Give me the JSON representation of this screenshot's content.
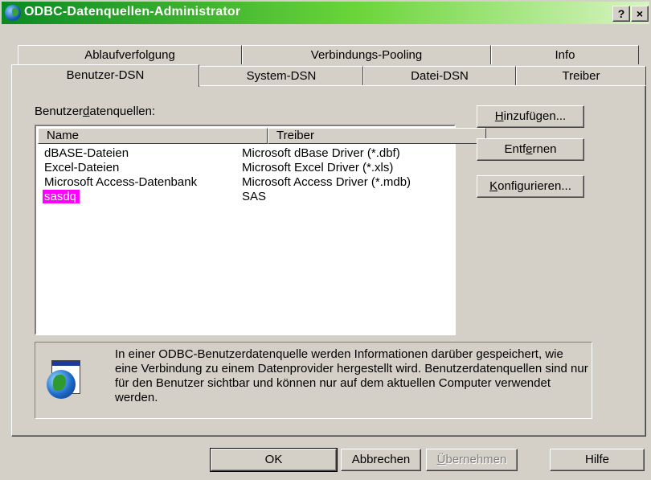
{
  "window": {
    "title": "ODBC-Datenquellen-Administrator",
    "help_btn": "?",
    "close_btn": "×"
  },
  "tabs": {
    "row_back": [
      "Ablaufverfolgung",
      "Verbindungs-Pooling",
      "Info"
    ],
    "row_front": [
      "Benutzer-DSN",
      "System-DSN",
      "Datei-DSN",
      "Treiber"
    ],
    "active": "Benutzer-DSN"
  },
  "user_dsn": {
    "list_label_pre": "Benutzer",
    "list_label_ul": "d",
    "list_label_post": "atenquellen:",
    "columns": [
      "Name",
      "Treiber"
    ],
    "rows": [
      {
        "name": "dBASE-Dateien",
        "driver": "Microsoft dBase Driver (*.dbf)"
      },
      {
        "name": "Excel-Dateien",
        "driver": "Microsoft Excel Driver (*.xls)"
      },
      {
        "name": "Microsoft Access-Datenbank",
        "driver": "Microsoft Access Driver (*.mdb)"
      },
      {
        "name": "sasdq",
        "driver": "SAS"
      }
    ],
    "selected_row": 3,
    "buttons": {
      "add_ul": "H",
      "add_rest": "inzufügen...",
      "remove_pre": "Entf",
      "remove_ul": "e",
      "remove_post": "rnen",
      "configure_ul": "K",
      "configure_rest": "onfigurieren..."
    },
    "info_text": "In einer ODBC-Benutzerdatenquelle werden Informationen darüber gespeichert, wie eine Verbindung zu einem Datenprovider hergestellt wird. Benutzerdatenquellen sind nur für den Benutzer sichtbar und können nur auf dem aktuellen Computer verwendet werden."
  },
  "footer": {
    "ok": "OK",
    "cancel": "Abbrechen",
    "apply_ul": "Ü",
    "apply_rest": "bernehmen",
    "help": "Hilfe"
  },
  "colors": {
    "selection": "#ff00ff",
    "titlebar_start": "#0a8a23",
    "titlebar_end": "#d8f4c2",
    "face": "#d4d0c8"
  }
}
